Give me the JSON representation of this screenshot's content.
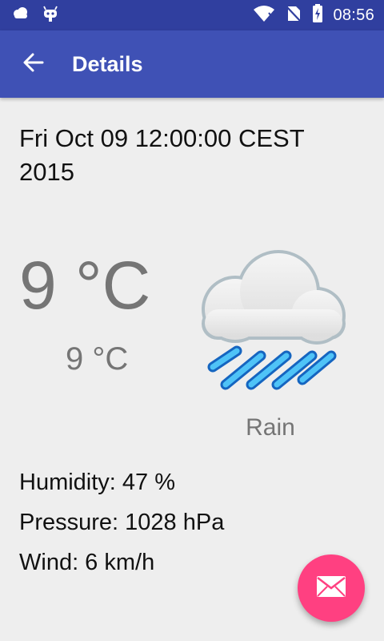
{
  "status_bar": {
    "time": "08:56",
    "icons": [
      "weather-cloud-icon",
      "android-debug-icon",
      "wifi-icon",
      "no-sim-icon",
      "battery-charging-icon"
    ]
  },
  "app_bar": {
    "back_icon": "arrow-left-icon",
    "title": "Details"
  },
  "forecast": {
    "date": "Fri Oct 09 12:00:00 CEST 2015",
    "temp_high": "9 °C",
    "temp_low": "9 °C",
    "condition_icon": "rain-cloud-icon",
    "condition": "Rain",
    "humidity": "Humidity: 47 %",
    "pressure": "Pressure: 1028 hPa",
    "wind": "Wind: 6 km/h"
  },
  "fab": {
    "icon": "mail-icon",
    "color": "#ff4081"
  },
  "colors": {
    "primary": "#3f51b5",
    "primary_dark": "#303f9f",
    "background": "#eeeeee"
  }
}
